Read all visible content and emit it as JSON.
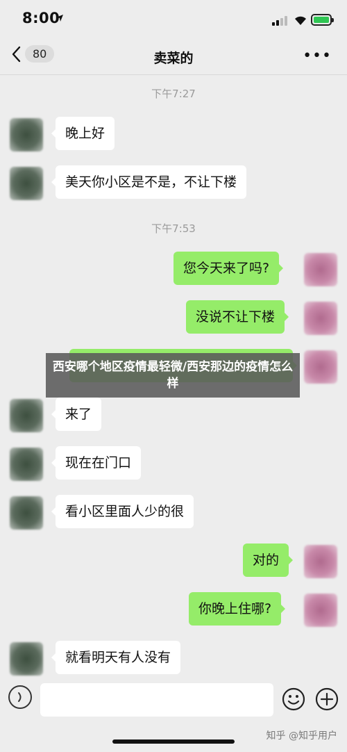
{
  "status_bar": {
    "time": "8:00"
  },
  "nav": {
    "back_count": "80",
    "title": "卖菜的",
    "more": "•••"
  },
  "chat": {
    "timestamp_1": "下午7:27",
    "timestamp_2": "下午7:53",
    "messages": [
      {
        "side": "left",
        "text": "晚上好"
      },
      {
        "side": "left",
        "text": "美天你小区是不是，不让下楼"
      },
      {
        "side": "right",
        "text": "您今天来了吗?"
      },
      {
        "side": "right",
        "text": "没说不让下楼"
      },
      {
        "side": "left",
        "text": "来了"
      },
      {
        "side": "left",
        "text": "现在在门口"
      },
      {
        "side": "left",
        "text": "看小区里面人少的很"
      },
      {
        "side": "right",
        "text": "对的"
      },
      {
        "side": "right",
        "text": "你晚上住哪?"
      },
      {
        "side": "left",
        "text": "就看明天有人没有"
      }
    ]
  },
  "overlay": {
    "title": "西安哪个地区疫情最轻微/西安那边的疫情怎么样"
  },
  "input": {
    "value": ""
  },
  "watermark": "知乎 @知乎用户",
  "colors": {
    "background": "#ededed",
    "sent_bubble": "#95ec69",
    "received_bubble": "#ffffff",
    "battery": "#2fc653"
  }
}
